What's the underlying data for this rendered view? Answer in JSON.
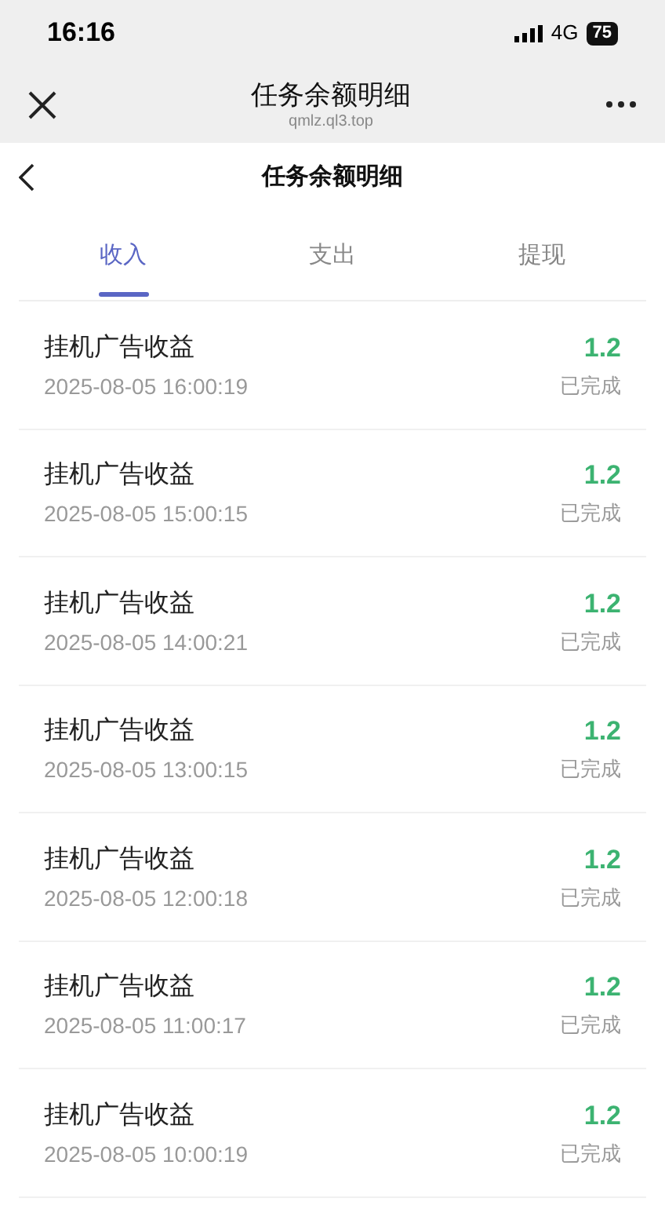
{
  "status_bar": {
    "time": "16:16",
    "network": "4G",
    "battery": "75"
  },
  "browser_bar": {
    "title": "任务余额明细",
    "url": "qmlz.ql3.top"
  },
  "page_header": {
    "title": "任务余额明细"
  },
  "tabs": [
    {
      "label": "收入",
      "selected": true
    },
    {
      "label": "支出",
      "selected": false
    },
    {
      "label": "提现",
      "selected": false
    }
  ],
  "records": [
    {
      "title": "挂机广告收益",
      "time": "2025-08-05 16:00:19",
      "amount": "1.2",
      "status": "已完成"
    },
    {
      "title": "挂机广告收益",
      "time": "2025-08-05 15:00:15",
      "amount": "1.2",
      "status": "已完成"
    },
    {
      "title": "挂机广告收益",
      "time": "2025-08-05 14:00:21",
      "amount": "1.2",
      "status": "已完成"
    },
    {
      "title": "挂机广告收益",
      "time": "2025-08-05 13:00:15",
      "amount": "1.2",
      "status": "已完成"
    },
    {
      "title": "挂机广告收益",
      "time": "2025-08-05 12:00:18",
      "amount": "1.2",
      "status": "已完成"
    },
    {
      "title": "挂机广告收益",
      "time": "2025-08-05 11:00:17",
      "amount": "1.2",
      "status": "已完成"
    },
    {
      "title": "挂机广告收益",
      "time": "2025-08-05 10:00:19",
      "amount": "1.2",
      "status": "已完成"
    }
  ]
}
